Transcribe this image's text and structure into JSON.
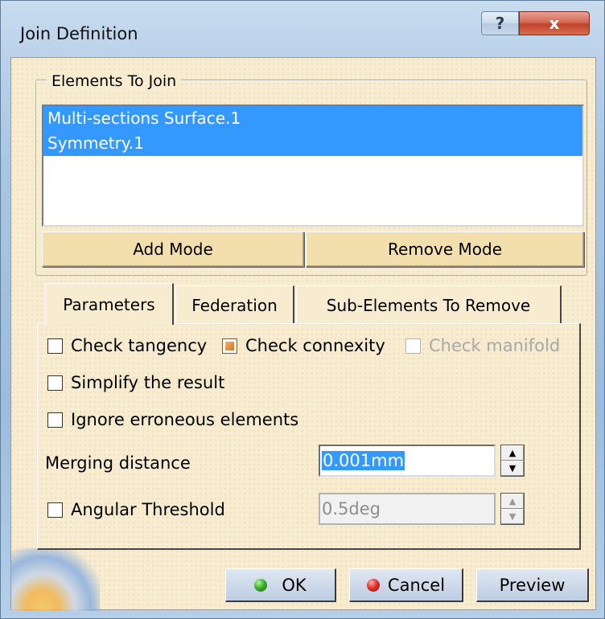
{
  "window": {
    "title": "Join Definition",
    "help_glyph": "?",
    "close_glyph": "x"
  },
  "elements_group": {
    "legend": "Elements To Join",
    "items": [
      {
        "label": "Multi-sections Surface.1",
        "selected": true
      },
      {
        "label": "Symmetry.1",
        "selected": true
      }
    ],
    "add_mode_label": "Add Mode",
    "remove_mode_label": "Remove Mode"
  },
  "tabs": [
    {
      "label": "Parameters",
      "active": true
    },
    {
      "label": "Federation",
      "active": false
    },
    {
      "label": "Sub-Elements To Remove",
      "active": false
    }
  ],
  "parameters": {
    "check_tangency": {
      "label": "Check tangency",
      "checked": false
    },
    "check_connexity": {
      "label": "Check connexity",
      "checked": true
    },
    "check_manifold": {
      "label": "Check manifold",
      "checked": false,
      "disabled": true
    },
    "simplify_result": {
      "label": "Simplify the result",
      "checked": false
    },
    "ignore_erroneous": {
      "label": "Ignore erroneous elements",
      "checked": false
    },
    "merging_distance": {
      "label": "Merging distance",
      "value": "0.001mm"
    },
    "angular_threshold": {
      "label": "Angular Threshold",
      "checked": false,
      "value": "0.5deg",
      "disabled": true
    }
  },
  "footer": {
    "ok_label": "OK",
    "cancel_label": "Cancel",
    "preview_label": "Preview"
  },
  "colors": {
    "dialog_background": "#f8ecd0",
    "selection": "#3399ff",
    "close_button": "#c0422b"
  },
  "icons": [
    "help-icon",
    "close-icon",
    "ok-green-dot-icon",
    "cancel-red-dot-icon",
    "spin-up-icon",
    "spin-down-icon",
    "app-logo"
  ]
}
